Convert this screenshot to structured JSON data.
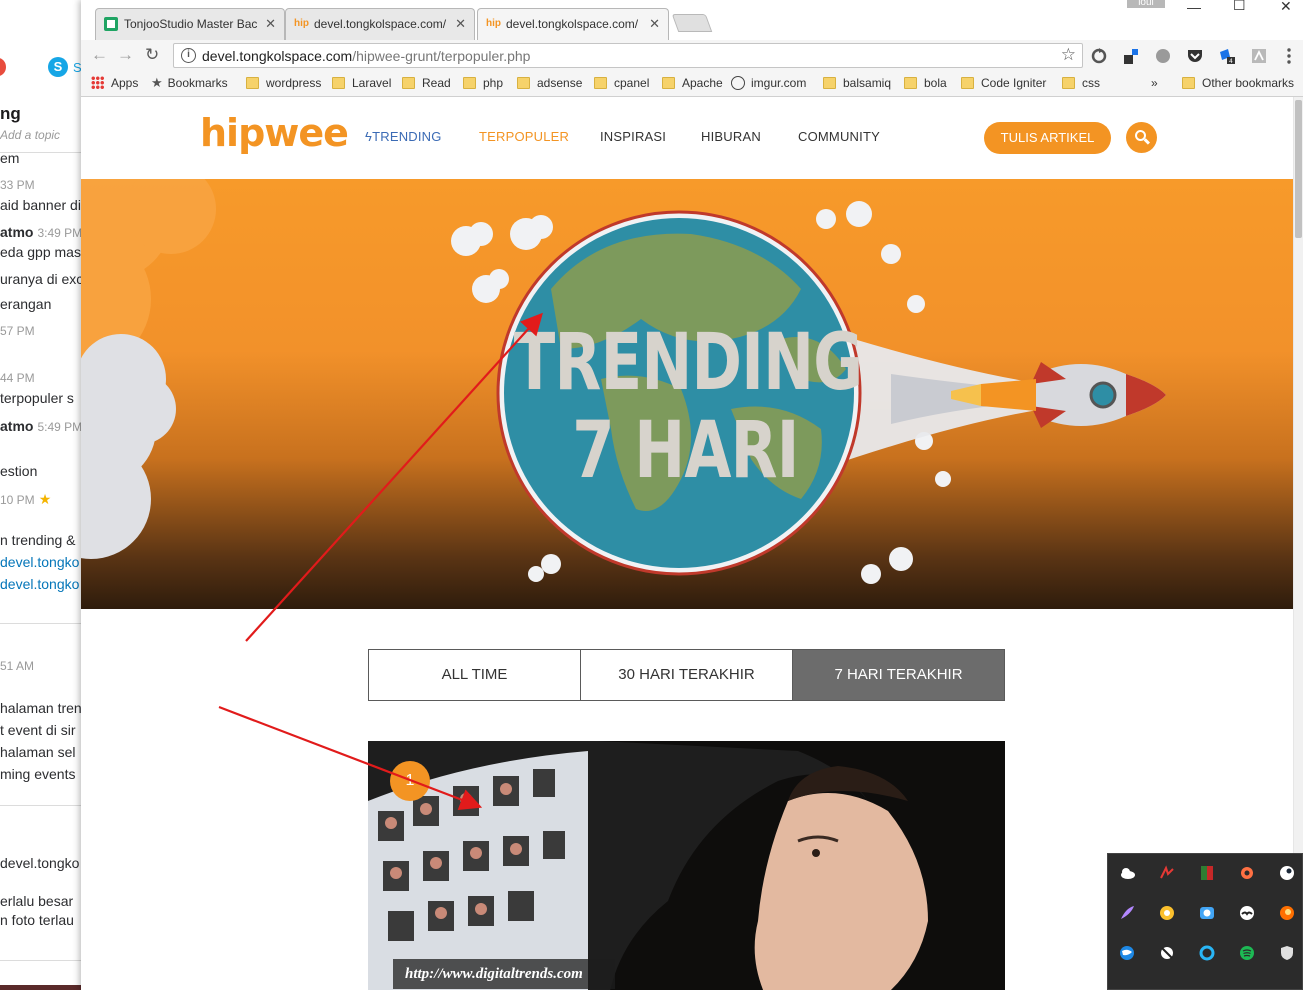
{
  "slack": {
    "channel_title": "ng",
    "topic_placeholder": "Add a topic",
    "lines": [
      {
        "text": "em",
        "kind": "normal"
      },
      {
        "text": "33 PM",
        "kind": "time"
      },
      {
        "text": "aid banner di",
        "kind": "normal"
      },
      {
        "text": "atmo",
        "time": "3:49 PM",
        "kind": "bold"
      },
      {
        "text": "eda gpp mas",
        "kind": "normal"
      },
      {
        "text": "uranya di exc",
        "kind": "normal"
      },
      {
        "text": "erangan",
        "kind": "normal"
      },
      {
        "text": "57 PM",
        "kind": "time"
      },
      {
        "text": "44 PM",
        "kind": "time"
      },
      {
        "text": "terpopuler s",
        "kind": "normal"
      },
      {
        "text": "atmo",
        "time": "5:49 PM",
        "kind": "bold"
      },
      {
        "text": "estion",
        "kind": "normal"
      },
      {
        "text": "10 PM",
        "kind": "time"
      },
      {
        "text": "n trending &",
        "kind": "normal"
      },
      {
        "text": "devel.tongko",
        "kind": "link"
      },
      {
        "text": "devel.tongko",
        "kind": "link"
      },
      {
        "text": "51 AM",
        "kind": "time"
      },
      {
        "text": "halaman tren",
        "kind": "normal"
      },
      {
        "text": "t event di sir",
        "kind": "normal"
      },
      {
        "text": " halaman sel",
        "kind": "normal"
      },
      {
        "text": "ming events",
        "kind": "normal"
      },
      {
        "text": "devel.tongko",
        "kind": "normal"
      },
      {
        "text": "erlalu besar",
        "kind": "normal"
      },
      {
        "text": "n foto terlau",
        "kind": "normal"
      }
    ],
    "skype_letter": "S",
    "skype_partial": "S"
  },
  "browser": {
    "tabs": [
      {
        "title": "TonjooStudio Master Bac",
        "favicon": "sheet-icon"
      },
      {
        "title": "devel.tongkolspace.com/",
        "favicon": "hip-icon"
      },
      {
        "title": "devel.tongkolspace.com/",
        "favicon": "hip-icon"
      }
    ],
    "user_badge": "ioul",
    "url_host": "devel.tongkolspace.com",
    "url_path": "/hipwee-grunt/terpopuler.php",
    "bookmarks": [
      {
        "label": "Apps",
        "icon": "apps-icon"
      },
      {
        "label": "Bookmarks",
        "icon": "star-icon"
      },
      {
        "label": "wordpress",
        "icon": "folder-icon"
      },
      {
        "label": "Laravel",
        "icon": "folder-icon"
      },
      {
        "label": "Read",
        "icon": "folder-icon"
      },
      {
        "label": "php",
        "icon": "folder-icon"
      },
      {
        "label": "adsense",
        "icon": "folder-icon"
      },
      {
        "label": "cpanel",
        "icon": "folder-icon"
      },
      {
        "label": "Apache",
        "icon": "folder-icon"
      },
      {
        "label": "imgur.com",
        "icon": "imgur-icon"
      },
      {
        "label": "balsamiq",
        "icon": "folder-icon"
      },
      {
        "label": "bola",
        "icon": "folder-icon"
      },
      {
        "label": "Code Igniter",
        "icon": "folder-icon"
      },
      {
        "label": "css",
        "icon": "folder-icon"
      }
    ],
    "more_bookmarks": "»",
    "other_bookmarks": "Other bookmarks"
  },
  "site": {
    "logo": "hipwee",
    "nav": [
      {
        "label": "TRENDING",
        "state": "trending"
      },
      {
        "label": "TERPOPULER",
        "state": "active"
      },
      {
        "label": "INSPIRASI",
        "state": "normal"
      },
      {
        "label": "HIBURAN",
        "state": "normal"
      },
      {
        "label": "COMMUNITY",
        "state": "normal"
      }
    ],
    "write_button": "TULIS ARTIKEL",
    "hero_line1": "TRENDING",
    "hero_line2": "7 HARI",
    "period_tabs": [
      "ALL TIME",
      "30 HARI TERAKHIR",
      "7 HARI TERAKHIR"
    ],
    "selected_period": "7 HARI TERAKHIR",
    "article": {
      "rank": "1",
      "caption": "http://www.digitaltrends.com"
    },
    "accent_color": "#f39423"
  }
}
